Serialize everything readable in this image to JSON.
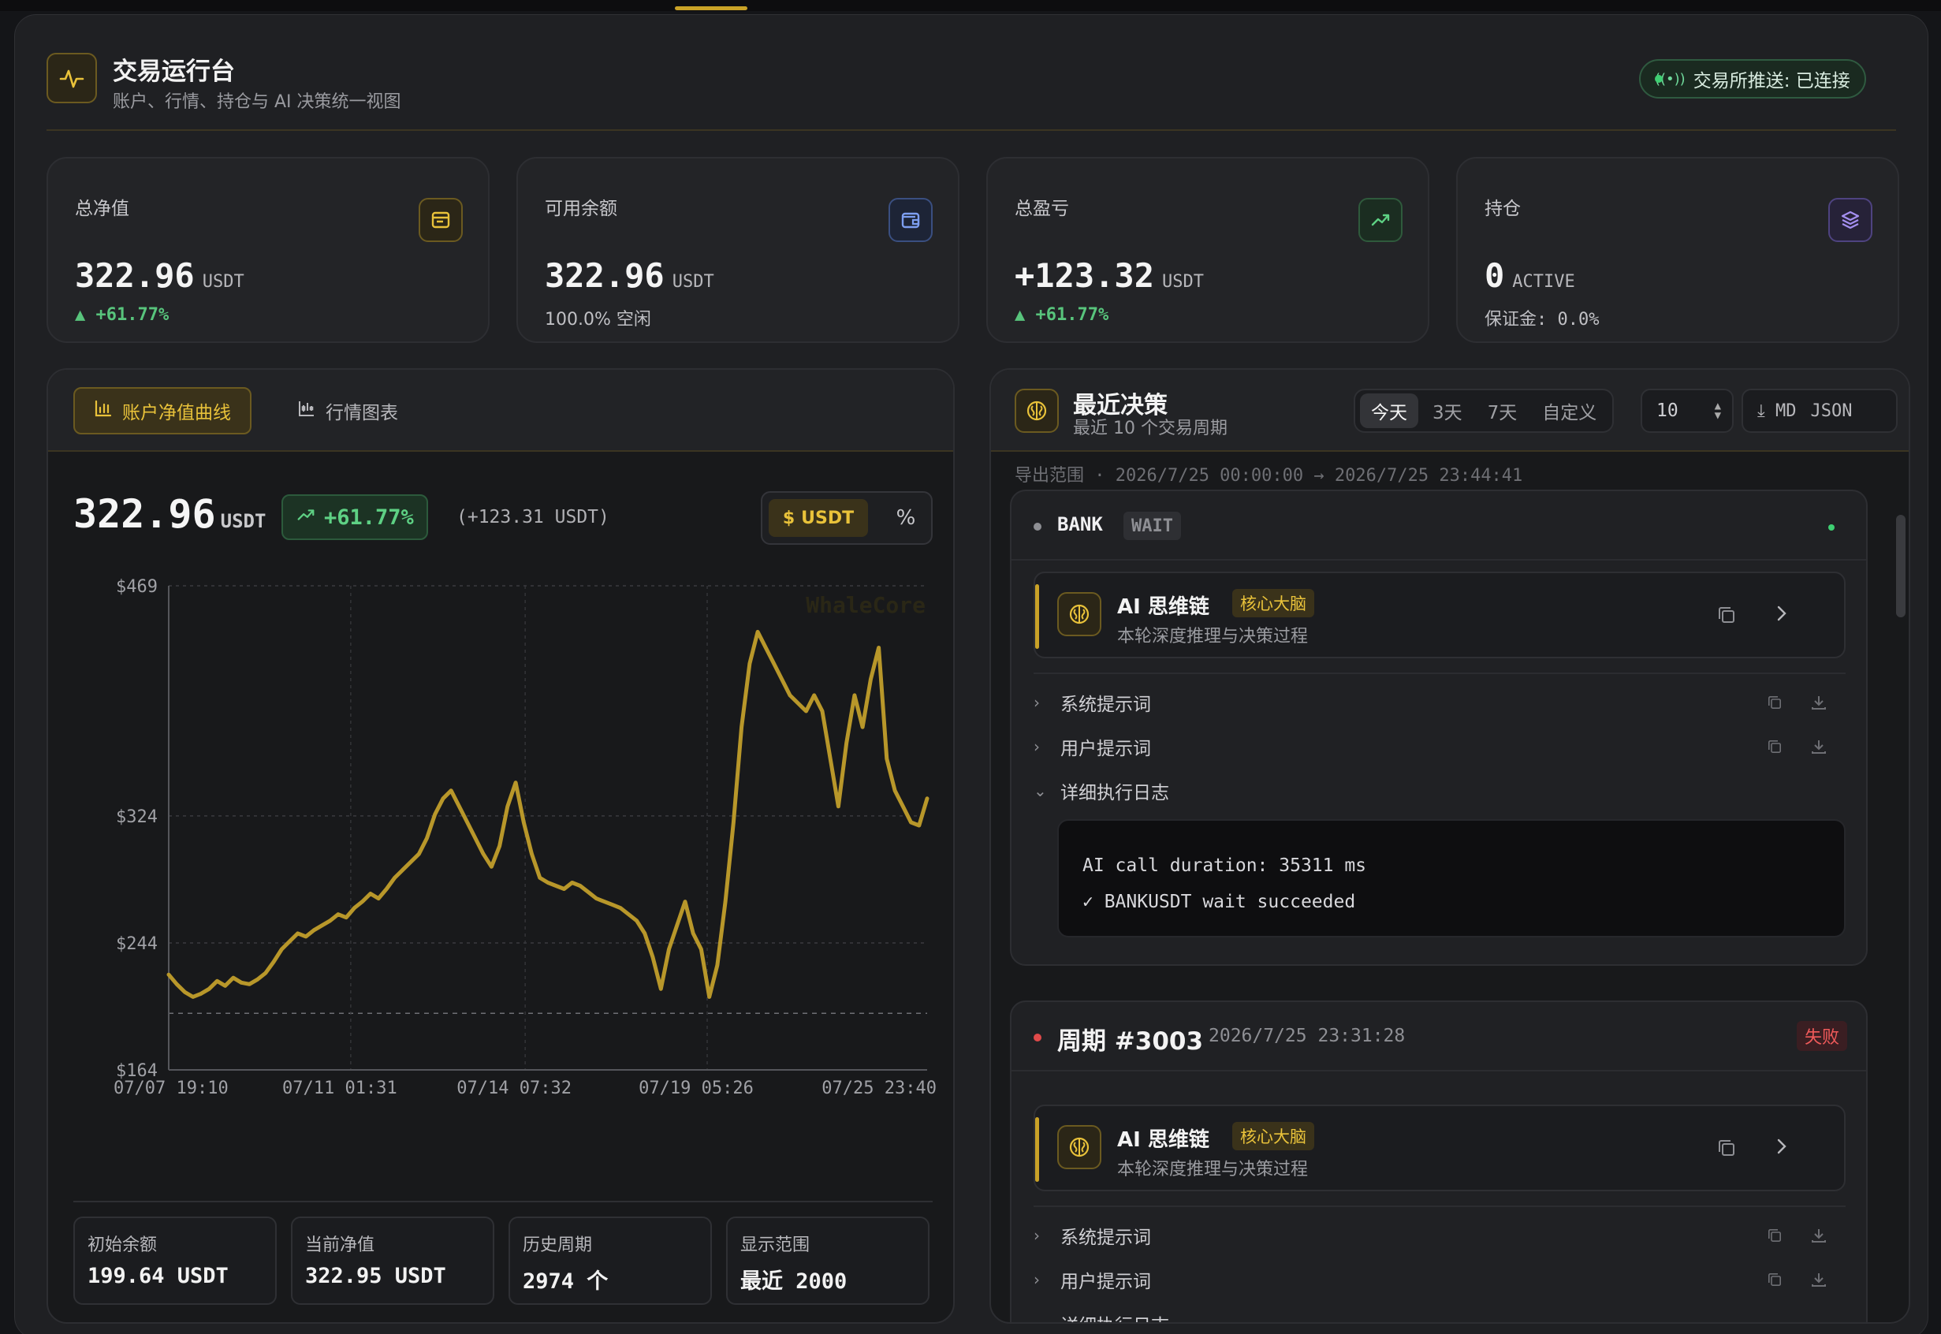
{
  "header": {
    "title": "交易运行台",
    "subtitle": "账户、行情、持仓与 AI 决策统一视图",
    "connection": "交易所推送: 已连接",
    "icon": "pulse-icon"
  },
  "stats": [
    {
      "label": "总净值",
      "value": "322.96",
      "unit": "USDT",
      "sub": "▲ +61.77%",
      "icon": "credit-card-icon",
      "accent": "#c9a227"
    },
    {
      "label": "可用余额",
      "value": "322.96",
      "unit": "USDT",
      "sub": "100.0% 空闲",
      "icon": "wallet-icon",
      "accent": "#5b7fd6"
    },
    {
      "label": "总盈亏",
      "value": "+123.32",
      "unit": "USDT",
      "sub": "▲ +61.77%",
      "icon": "trending-up-icon",
      "accent": "#4caf6a"
    },
    {
      "label": "持仓",
      "value": "0",
      "unit": "ACTIVE",
      "sub": "保证金: 0.0%",
      "icon": "layers-icon",
      "accent": "#8a6fd6"
    }
  ],
  "equity": {
    "tab_active": "账户净值曲线",
    "tab_inactive": "行情图表",
    "value": "322.96",
    "unit": "USDT",
    "pct": "+61.77%",
    "abs_change": "(+123.31 USDT)",
    "toggle_usdt": "USDT",
    "toggle_pct": "%",
    "watermark": "WhaleCore",
    "summary": [
      {
        "label": "初始余额",
        "value": "199.64 USDT"
      },
      {
        "label": "当前净值",
        "value": "322.95 USDT"
      },
      {
        "label": "历史周期",
        "value": "2974 个"
      },
      {
        "label": "显示范围",
        "value": "最近 2000"
      }
    ]
  },
  "chart_data": {
    "type": "line",
    "title": "",
    "ylabel": "",
    "xlabel": "",
    "ylim": [
      164,
      469
    ],
    "y_ticks": [
      "$469",
      "$324",
      "$244",
      "$164"
    ],
    "x_ticks": [
      "07/07 19:10",
      "07/11 01:31",
      "07/14 07:32",
      "07/19 05:26",
      "07/25 23:40"
    ],
    "baseline": 199.64,
    "color": "#b8972a",
    "series": [
      {
        "values": [
          224,
          218,
          213,
          210,
          212,
          215,
          220,
          217,
          222,
          219,
          218,
          221,
          225,
          232,
          240,
          245,
          250,
          248,
          252,
          255,
          258,
          262,
          260,
          266,
          270,
          275,
          272,
          278,
          285,
          290,
          295,
          300,
          310,
          325,
          335,
          340,
          330,
          320,
          310,
          300,
          292,
          305,
          330,
          345,
          320,
          300,
          285,
          282,
          280,
          278,
          282,
          280,
          276,
          272,
          270,
          268,
          266,
          262,
          258,
          250,
          235,
          215,
          240,
          255,
          270,
          250,
          240,
          210,
          230,
          270,
          320,
          380,
          420,
          440,
          430,
          420,
          410,
          400,
          395,
          390,
          400,
          390,
          360,
          330,
          370,
          400,
          380,
          410,
          430,
          360,
          340,
          330,
          320,
          318,
          335
        ]
      }
    ]
  },
  "decisions": {
    "title": "最近决策",
    "subtitle": "最近 10 个交易周期",
    "ranges": [
      "今天",
      "3天",
      "7天",
      "自定义"
    ],
    "active_range": "今天",
    "count": "10",
    "export_md": "MD",
    "export_json": "JSON",
    "export_range": "导出范围 · 2026/7/25 00:00:00 → 2026/7/25 23:44:41",
    "card1": {
      "symbol": "BANK",
      "status": "WAIT",
      "ai_title": "AI 思维链",
      "ai_tag": "核心大脑",
      "ai_sub": "本轮深度推理与决策过程",
      "rows": [
        "系统提示词",
        "用户提示词",
        "详细执行日志"
      ],
      "log": [
        "AI call duration: 35311 ms",
        "✓ BANKUSDT wait succeeded"
      ]
    },
    "card2": {
      "cycle": "周期 #3003",
      "time": "2026/7/25 23:31:28",
      "status": "失败",
      "ai_title": "AI 思维链",
      "ai_tag": "核心大脑",
      "ai_sub": "本轮深度推理与决策过程",
      "rows": [
        "系统提示词",
        "用户提示词",
        "详细执行日志"
      ]
    }
  }
}
